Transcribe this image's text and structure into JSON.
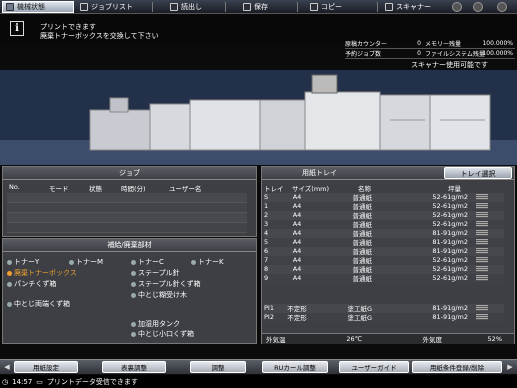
{
  "tabs": {
    "status": "機械状態",
    "job_list": "ジョブリスト",
    "recall": "読出し",
    "save": "保存",
    "copy": "コピー",
    "scan": "スキャナー"
  },
  "message": {
    "line1": "プリントできます",
    "line2": "廃棄トナーボックスを交換して下さい"
  },
  "counters": {
    "original_label": "原稿カウンター",
    "original_value": "0",
    "memory_label": "メモリー残量",
    "memory_value": "100.000%",
    "reserve_label": "予約ジョブ数",
    "reserve_value": "0",
    "fs_label": "ファイルシステム残量",
    "fs_value": "100.000%"
  },
  "scanner_status": "スキャナー使用可能です",
  "jobs": {
    "title": "ジョブ",
    "col_no": "No.",
    "col_mode": "モード",
    "col_state": "状態",
    "col_time": "時間(分)",
    "col_user": "ユーザー名"
  },
  "supplies": {
    "title": "補給/廃棄部材",
    "toner_y": "トナーY",
    "toner_m": "トナーM",
    "toner_c": "トナーC",
    "toner_k": "トナーK",
    "waste_toner": "廃棄トナーボックス",
    "staple": "ステープル針",
    "punch_box": "パンチくず箱",
    "staple_waste": "ステープル針くず箱",
    "saddle_receiver": "中とじ糊受け木",
    "saddle_trim": "中とじ両端くず箱",
    "glue_tank": "加湿用タンク",
    "saddle_small": "中とじ小口くず箱"
  },
  "trays": {
    "title": "用紙トレイ",
    "select_button": "トレイ選択",
    "col_tray": "トレイ",
    "col_size": "サイズ(mm)",
    "col_name": "名称",
    "col_weight": "坪量",
    "rows": [
      {
        "tray": "S",
        "size": "A4",
        "name": "普通紙",
        "weight": "52-61g/m2"
      },
      {
        "tray": "1",
        "size": "A4",
        "name": "普通紙",
        "weight": "52-61g/m2"
      },
      {
        "tray": "2",
        "size": "A4",
        "name": "普通紙",
        "weight": "52-61g/m2"
      },
      {
        "tray": "3",
        "size": "A4",
        "name": "普通紙",
        "weight": "52-61g/m2"
      },
      {
        "tray": "4",
        "size": "A4",
        "name": "普通紙",
        "weight": "81-91g/m2"
      },
      {
        "tray": "5",
        "size": "A4",
        "name": "普通紙",
        "weight": "81-91g/m2"
      },
      {
        "tray": "6",
        "size": "A4",
        "name": "普通紙",
        "weight": "81-91g/m2"
      },
      {
        "tray": "7",
        "size": "A4",
        "name": "普通紙",
        "weight": "52-61g/m2"
      },
      {
        "tray": "8",
        "size": "A4",
        "name": "普通紙",
        "weight": "52-61g/m2"
      },
      {
        "tray": "9",
        "size": "A4",
        "name": "普通紙",
        "weight": "52-61g/m2"
      }
    ],
    "rows_pi": [
      {
        "tray": "PI1",
        "size": "不定形",
        "name": "塗工紙G",
        "weight": "81-91g/m2"
      },
      {
        "tray": "PI2",
        "size": "不定形",
        "name": "塗工紙G",
        "weight": "81-91g/m2"
      }
    ],
    "temp_label": "外気温",
    "temp_value": "26℃",
    "humidity_label": "外気度",
    "humidity_value": "52%"
  },
  "bottom": {
    "b1": "用紙設定",
    "b2": "表裏調整",
    "b3": "調整",
    "b4": "RUカール調整",
    "b5": "ユーザーガイド",
    "b6": "用紙条件登録/削除"
  },
  "status": {
    "time": "14:57",
    "text": "プリントデータ受信できます"
  }
}
